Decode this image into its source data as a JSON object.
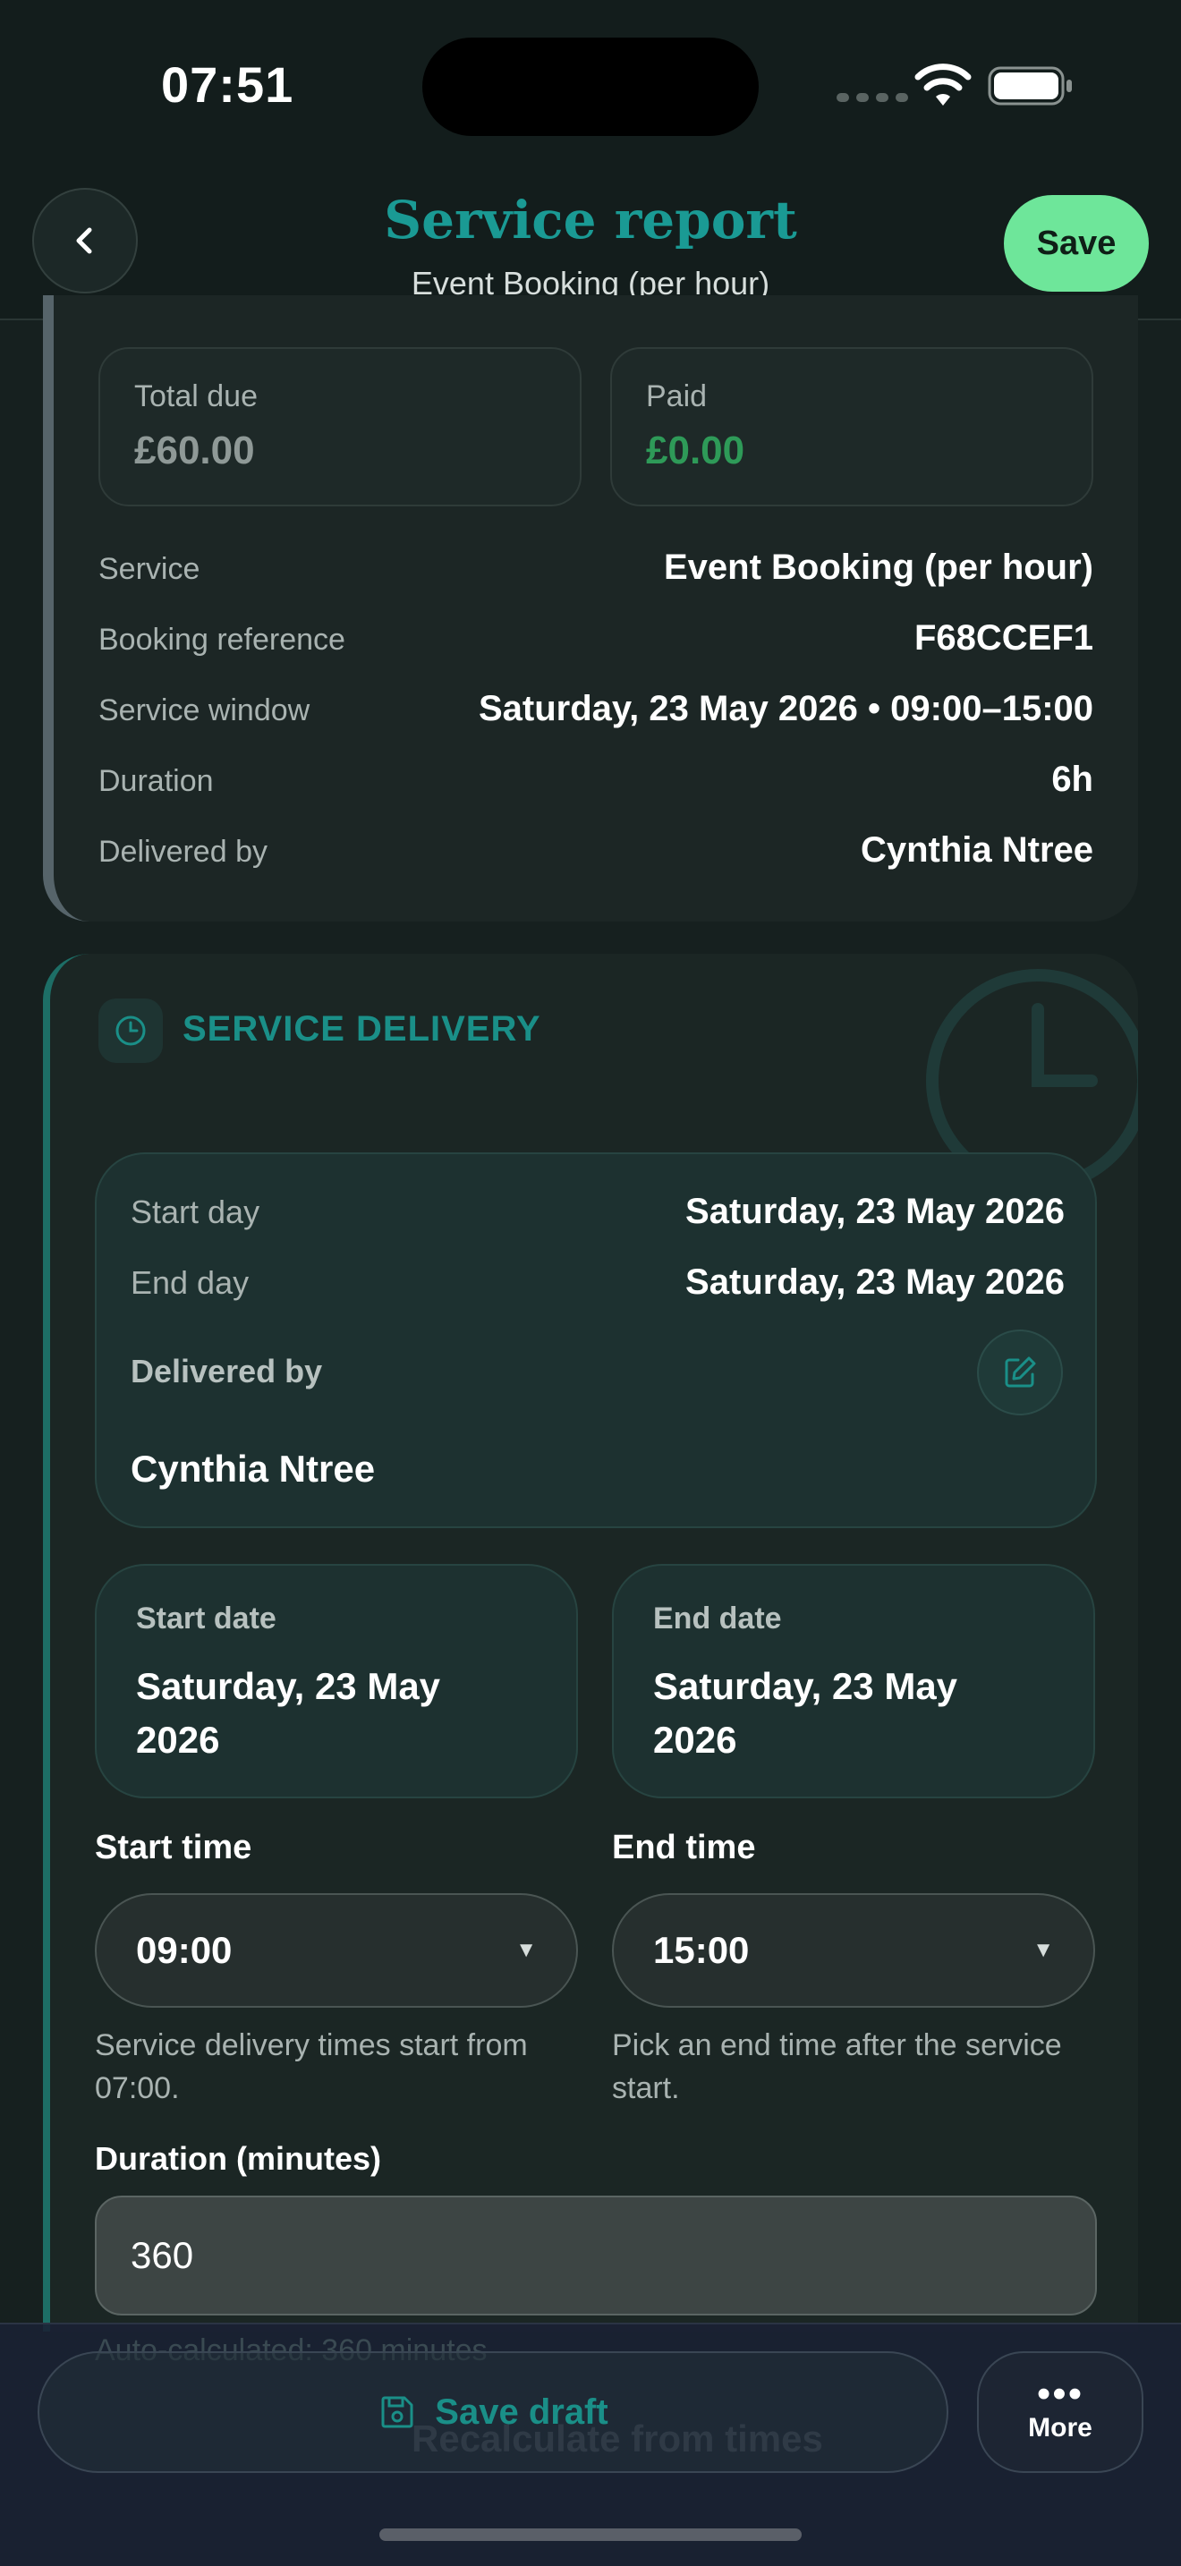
{
  "status_bar": {
    "time": "07:51"
  },
  "nav": {
    "title": "Service report",
    "subtitle": "Event Booking (per hour)",
    "save_label": "Save"
  },
  "summary": {
    "total_due_label": "Total due",
    "total_due_value": "£60.00",
    "paid_label": "Paid",
    "paid_value": "£0.00",
    "rows": [
      {
        "label": "Service",
        "value": "Event Booking (per hour)"
      },
      {
        "label": "Booking reference",
        "value": "F68CCEF1"
      },
      {
        "label": "Service window",
        "value": "Saturday, 23 May 2026 • 09:00–15:00"
      },
      {
        "label": "Duration",
        "value": "6h"
      },
      {
        "label": "Delivered by",
        "value": "Cynthia Ntree"
      }
    ]
  },
  "delivery": {
    "section_title": "SERVICE DELIVERY",
    "start_day_label": "Start day",
    "start_day_value": "Saturday, 23 May 2026",
    "end_day_label": "End day",
    "end_day_value": "Saturday, 23 May 2026",
    "delivered_by_label": "Delivered by",
    "delivered_by_value": "Cynthia Ntree",
    "start_date_label": "Start date",
    "start_date_value": "Saturday, 23 May 2026",
    "end_date_label": "End date",
    "end_date_value": "Saturday, 23 May 2026",
    "start_time_label": "Start time",
    "start_time_value": "09:00",
    "start_time_helper": "Service delivery times start from 07:00.",
    "end_time_label": "End time",
    "end_time_value": "15:00",
    "end_time_helper": "Pick an end time after the service start.",
    "duration_label": "Duration (minutes)",
    "duration_value": "360",
    "duration_helper": "Auto-calculated: 360 minutes",
    "recalculate_label": "Recalculate from times"
  },
  "bottom_bar": {
    "save_draft_label": "Save draft",
    "more_label": "More"
  },
  "colors": {
    "accent_teal": "#1a9a94",
    "save_green": "#6ee69a",
    "paid_green": "#2e9a58"
  }
}
